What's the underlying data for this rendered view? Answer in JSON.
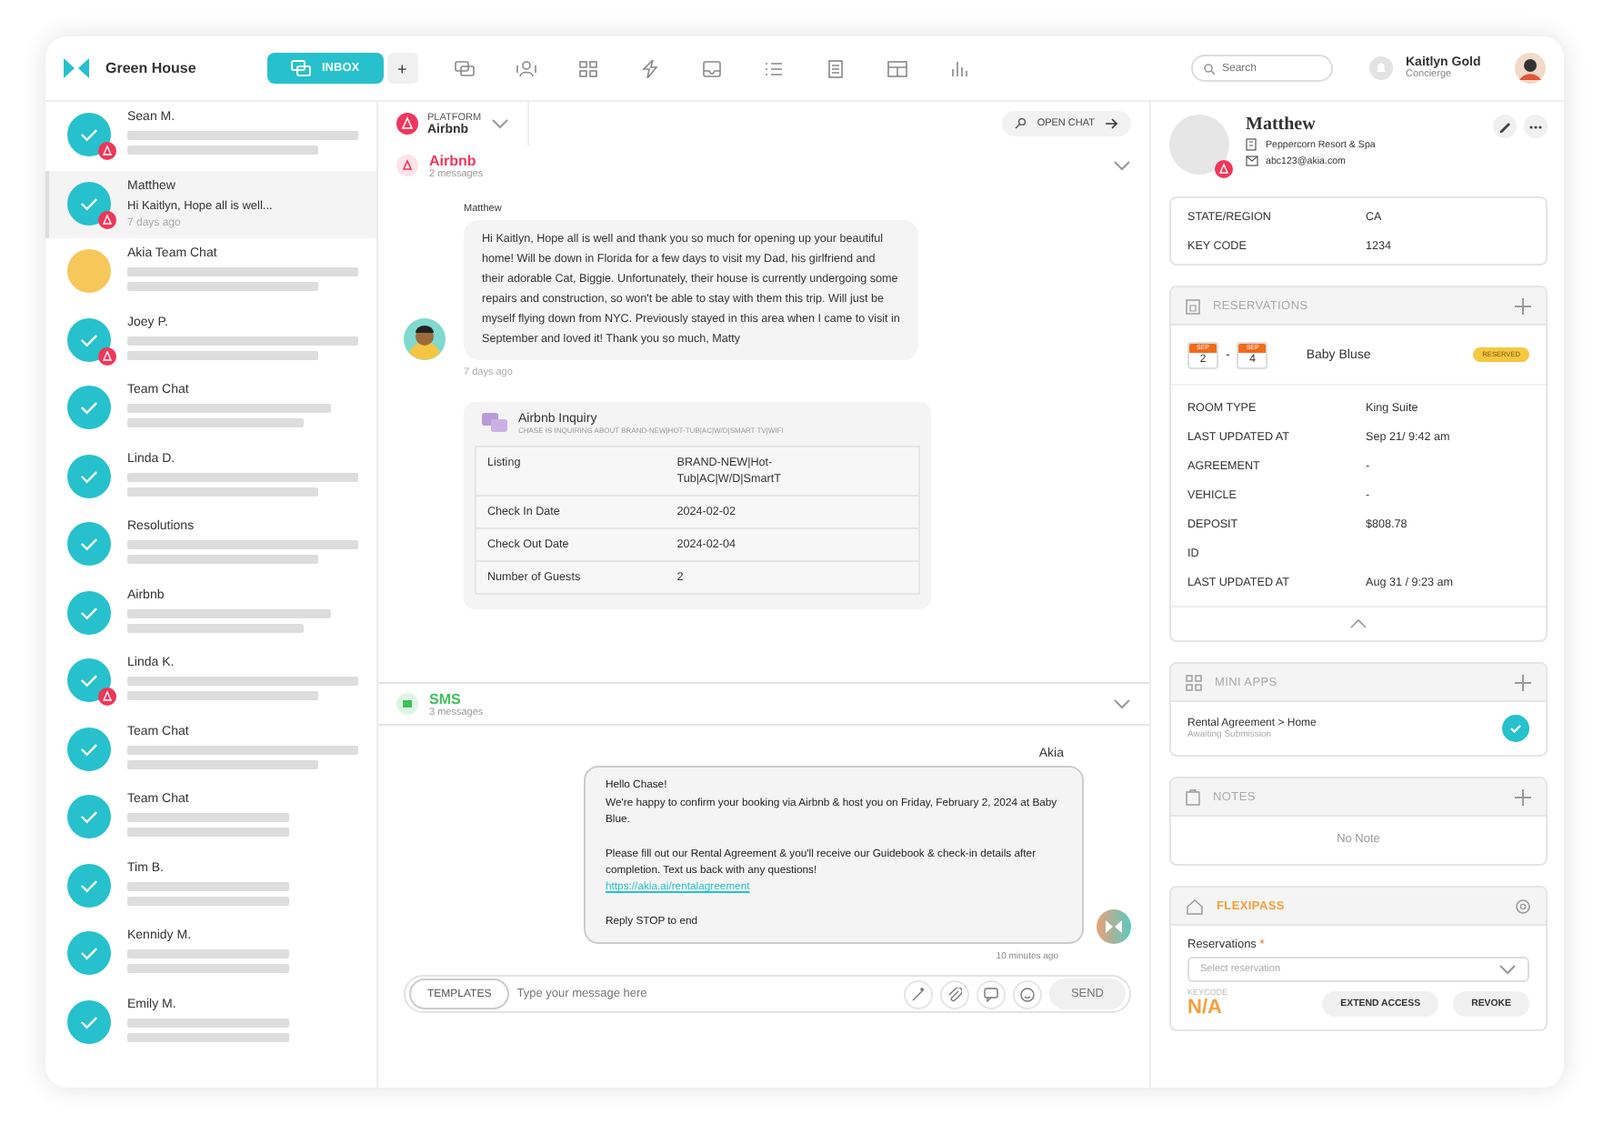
{
  "header": {
    "brand": "Green House",
    "inbox_tab": {
      "label": "INBOX",
      "selected": true
    },
    "add_label": "+",
    "search": {
      "placeholder": "Search"
    },
    "user": {
      "name": "Kaitlyn Gold",
      "role": "Concierge"
    }
  },
  "conversations": [
    {
      "name": "Sean M.",
      "kind": "check",
      "badge": true,
      "selected": false
    },
    {
      "name": "Matthew",
      "kind": "check",
      "badge": true,
      "selected": true,
      "preview": "Hi Kaitlyn, Hope all is well...",
      "time": "7 days ago"
    },
    {
      "name": "Akia Team Chat",
      "kind": "plain",
      "badge": false,
      "selected": false
    },
    {
      "name": "Joey P.",
      "kind": "check",
      "badge": true,
      "selected": false
    },
    {
      "name": "Team Chat",
      "kind": "check",
      "badge": false,
      "selected": false
    },
    {
      "name": "Linda D.",
      "kind": "check",
      "badge": false,
      "selected": false
    },
    {
      "name": "Resolutions",
      "kind": "check",
      "badge": false,
      "selected": false
    },
    {
      "name": "Airbnb",
      "kind": "check",
      "badge": false,
      "selected": false
    },
    {
      "name": "Linda K.",
      "kind": "check",
      "badge": true,
      "selected": false
    },
    {
      "name": "Team Chat",
      "kind": "check",
      "badge": false,
      "selected": false
    },
    {
      "name": "Team Chat",
      "kind": "check",
      "badge": false,
      "selected": false
    },
    {
      "name": "Tim B.",
      "kind": "check",
      "badge": false,
      "selected": false
    },
    {
      "name": "Kennidy M.",
      "kind": "check",
      "badge": false,
      "selected": false
    },
    {
      "name": "Emily M.",
      "kind": "check",
      "badge": false,
      "selected": false
    }
  ],
  "chat": {
    "platform": {
      "label": "PLATFORM",
      "value": "Airbnb"
    },
    "open_chat": "OPEN CHAT",
    "airbnb_thread": {
      "title": "Airbnb",
      "count": "2 messages",
      "sender": "Matthew",
      "message": "Hi Kaitlyn, Hope all is well and thank you so much for opening up your beautiful home! Will be down in Florida for a few days to visit my Dad, his girlfriend and their adorable Cat, Biggie. Unfortunately, their house is currently undergoing some repairs and construction, so won't be able to stay with them this trip. Will just be myself flying down from NYC. Previously stayed in this area when I came to visit in September and loved it! Thank you so much, Matty",
      "time": "7 days ago",
      "inquiry": {
        "title": "Airbnb Inquiry",
        "subtitle": "CHASE IS INQUIRING ABOUT BRAND-NEW|HOT-TUB|AC|W/D|SMART TV|WIFI",
        "rows": [
          {
            "label": "Listing",
            "value": "BRAND-NEW|Hot-Tub|AC|W/D|SmartT"
          },
          {
            "label": "Check In Date",
            "value": "2024-02-02"
          },
          {
            "label": "Check Out Date",
            "value": "2024-02-04"
          },
          {
            "label": "Number of Guests",
            "value": "2"
          }
        ]
      }
    },
    "sms_thread": {
      "title": "SMS",
      "count": "3 messages",
      "sender": "Akia",
      "blocks": [
        [
          {
            "kind": "text",
            "text": "Hello Chase!"
          },
          {
            "kind": "text",
            "text": "We're happy to confirm your booking via Airbnb & host you on Friday, February 2, 2024 at Baby Blue."
          }
        ],
        [
          {
            "kind": "text",
            "text": "Please fill out our Rental Agreement & you'll receive our Guidebook & check-in details after completion. Text us back with any questions!"
          },
          {
            "kind": "link",
            "text": "https://akia.ai/rentalagreement"
          }
        ],
        [
          {
            "kind": "text",
            "text": "Reply STOP to end"
          }
        ]
      ],
      "time": "10 minutes ago"
    },
    "composer": {
      "templates": "TEMPLATES",
      "placeholder": "Type your message here",
      "send": "SEND"
    }
  },
  "contact": {
    "name": "Matthew",
    "property": "Peppercorn Resort & Spa",
    "email": "abc123@akia.com",
    "details": [
      {
        "label": "STATE/REGION",
        "value": "CA"
      },
      {
        "label": "KEY CODE",
        "value": "1234"
      }
    ],
    "reservations": {
      "title": "RESERVATIONS",
      "start": {
        "month": "SEP",
        "day": "2"
      },
      "separator": "-",
      "end": {
        "month": "SEP",
        "day": "4"
      },
      "name": "Baby Bluse",
      "status": "RESERVED",
      "rows": [
        {
          "label": "ROOM TYPE",
          "value": "King Suite"
        },
        {
          "label": "LAST UPDATED AT",
          "value": "Sep 21/ 9:42 am"
        },
        {
          "label": "AGREEMENT",
          "value": "-"
        },
        {
          "label": "VEHICLE",
          "value": "-"
        },
        {
          "label": "DEPOSIT",
          "value": "$808.78"
        },
        {
          "label": "ID"
        },
        {
          "label": "LAST UPDATED AT",
          "value": "Aug 31 / 9:23 am"
        }
      ]
    },
    "mini_apps": {
      "title": "MINI APPS",
      "items": [
        {
          "name": "Rental Agreement > Home",
          "status": "Awaiting Submission",
          "checked": true
        }
      ]
    },
    "notes": {
      "title": "NOTES",
      "empty": "No Note"
    },
    "flexipass": {
      "title": "FLEXIPASS",
      "field_label": "Reservations",
      "required_mark": "*",
      "placeholder": "Select reservation",
      "keycode_label": "KEYCODE",
      "keycode": "N/A",
      "buttons": [
        "EXTEND ACCESS",
        "REVOKE"
      ]
    }
  }
}
